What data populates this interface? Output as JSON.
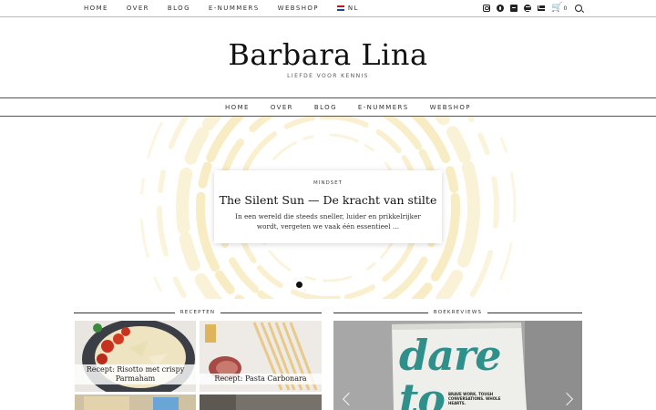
{
  "topbar": {
    "nav": [
      "HOME",
      "OVER",
      "BLOG",
      "E-NUMMERS",
      "WEBSHOP"
    ],
    "language": "NL",
    "cart_count": "0",
    "social_icons": [
      "instagram-icon",
      "pinterest-icon",
      "bloglovin-icon",
      "spotify-icon",
      "email-icon"
    ]
  },
  "site": {
    "title": "Barbara Lina",
    "tagline": "LIEFDE VOOR KENNIS"
  },
  "mainnav": [
    "HOME",
    "OVER",
    "BLOG",
    "E-NUMMERS",
    "WEBSHOP"
  ],
  "hero": {
    "category": "MINDSET",
    "title": "The Silent Sun — De kracht van stilte",
    "excerpt": "In een wereld die steeds sneller, luider en prikkelrijker wordt, vergeten we vaak één essentieel …"
  },
  "recepten": {
    "heading": "RECEPTEN",
    "items": [
      {
        "caption": "Recept: Risotto met crispy Parmaham"
      },
      {
        "caption": "Recept: Pasta Carbonara"
      }
    ]
  },
  "boekreviews": {
    "heading": "BOEKREVIEWS",
    "book_text": "dare to",
    "book_subtext": "BRAVE WORK. TOUGH CONVERSATIONS. WHOLE HEARTS."
  },
  "colors": {
    "accent_swirl": "#f2d98a",
    "text": "#222222",
    "book_teal": "#2f8f8a"
  }
}
